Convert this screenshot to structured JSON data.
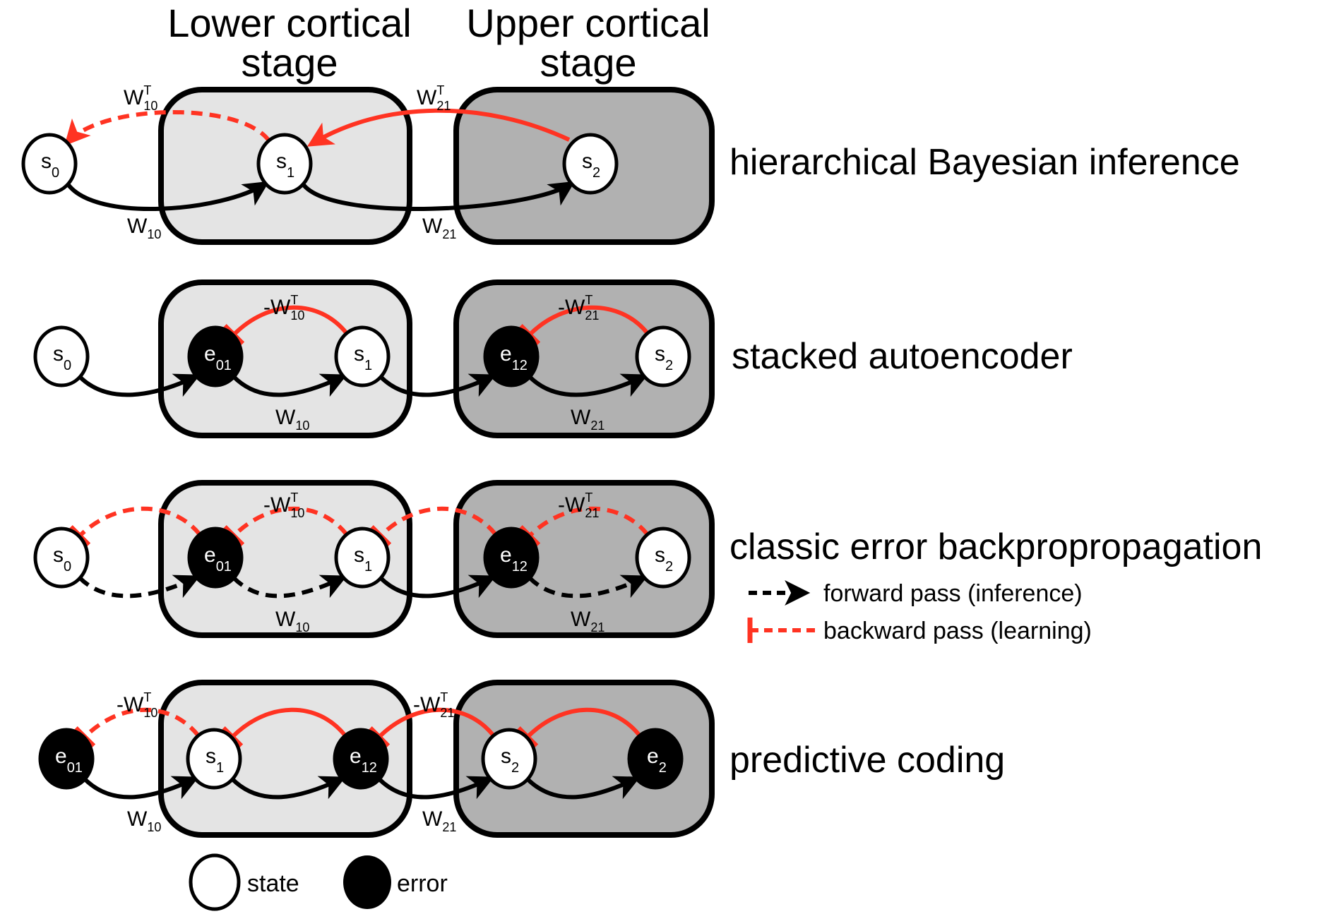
{
  "headers": {
    "lower": [
      "Lower cortical",
      "stage"
    ],
    "upper": [
      "Upper cortical",
      "stage"
    ]
  },
  "colors": {
    "lower_stage_fill": "#e4e4e4",
    "upper_stage_fill": "#b1b1b1",
    "feedback": "#ff3322",
    "feedforward": "#000000",
    "state_node": "#ffffff",
    "error_node": "#000000"
  },
  "rows": [
    {
      "label": "hierarchical Bayesian inference",
      "nodes": [
        {
          "type": "state",
          "base": "s",
          "sub": "0"
        },
        {
          "type": "state",
          "base": "s",
          "sub": "1"
        },
        {
          "type": "state",
          "base": "s",
          "sub": "2"
        }
      ],
      "forward_labels": [
        {
          "base": "W",
          "sub": "10"
        },
        {
          "base": "W",
          "sub": "21"
        }
      ],
      "backward_labels": [
        {
          "base": "W",
          "sup": "T",
          "sub": "10"
        },
        {
          "base": "W",
          "sup": "T",
          "sub": "21"
        }
      ]
    },
    {
      "label": "stacked autoencoder",
      "nodes": [
        {
          "type": "state",
          "base": "s",
          "sub": "0"
        },
        {
          "type": "error",
          "base": "e",
          "sub": "01"
        },
        {
          "type": "state",
          "base": "s",
          "sub": "1"
        },
        {
          "type": "error",
          "base": "e",
          "sub": "12"
        },
        {
          "type": "state",
          "base": "s",
          "sub": "2"
        }
      ],
      "forward_labels": [
        {
          "base": "W",
          "sub": "10"
        },
        {
          "base": "W",
          "sub": "21"
        }
      ],
      "backward_labels": [
        {
          "base": "-W",
          "sup": "T",
          "sub": "10"
        },
        {
          "base": "-W",
          "sup": "T",
          "sub": "21"
        }
      ]
    },
    {
      "label": "classic error backpropropagation",
      "nodes": [
        {
          "type": "state",
          "base": "s",
          "sub": "0"
        },
        {
          "type": "error",
          "base": "e",
          "sub": "01"
        },
        {
          "type": "state",
          "base": "s",
          "sub": "1"
        },
        {
          "type": "error",
          "base": "e",
          "sub": "12"
        },
        {
          "type": "state",
          "base": "s",
          "sub": "2"
        }
      ],
      "forward_labels": [
        {
          "base": "W",
          "sub": "10"
        },
        {
          "base": "W",
          "sub": "21"
        }
      ],
      "backward_labels": [
        {
          "base": "-W",
          "sup": "T",
          "sub": "10"
        },
        {
          "base": "-W",
          "sup": "T",
          "sub": "21"
        }
      ]
    },
    {
      "label": "predictive coding",
      "nodes": [
        {
          "type": "error",
          "base": "e",
          "sub": "01"
        },
        {
          "type": "state",
          "base": "s",
          "sub": "1"
        },
        {
          "type": "error",
          "base": "e",
          "sub": "12"
        },
        {
          "type": "state",
          "base": "s",
          "sub": "2"
        },
        {
          "type": "error",
          "base": "e",
          "sub": "2"
        }
      ],
      "forward_labels": [
        {
          "base": "W",
          "sub": "10"
        },
        {
          "base": "W",
          "sub": "21"
        }
      ],
      "backward_labels": [
        {
          "base": "-W",
          "sup": "T",
          "sub": "10"
        },
        {
          "base": "-W",
          "sup": "T",
          "sub": "21"
        }
      ]
    }
  ],
  "pass_legend": {
    "forward": "forward pass (inference)",
    "backward": "backward pass (learning)"
  },
  "node_legend": {
    "state": "state",
    "error": "error"
  }
}
